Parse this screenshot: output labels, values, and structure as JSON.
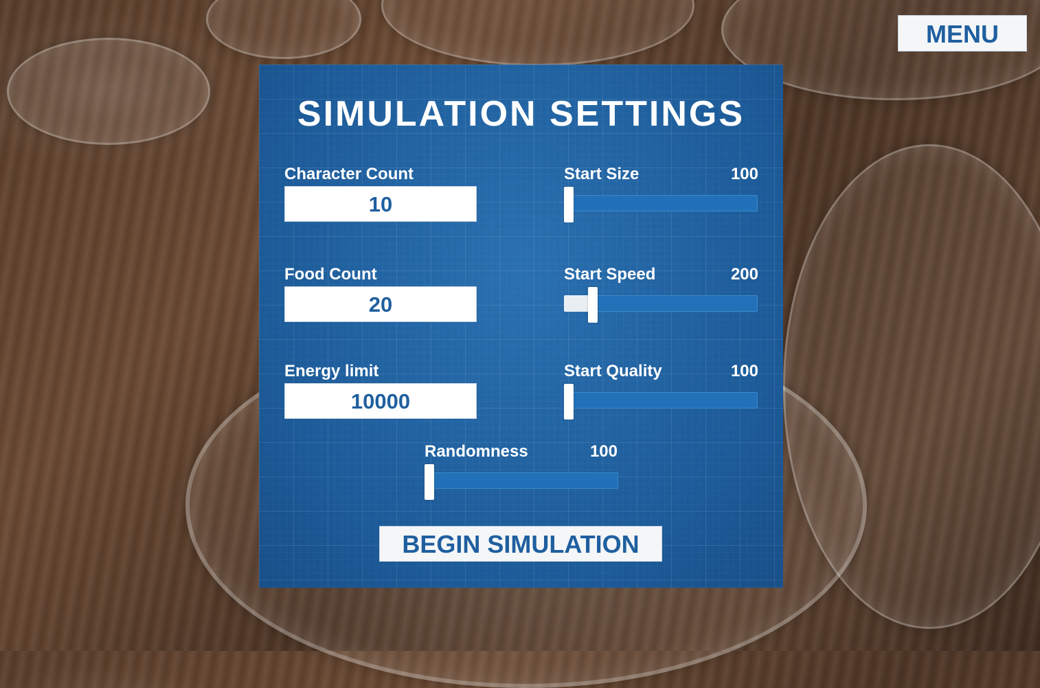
{
  "menu_label": "MENU",
  "panel": {
    "title": "SIMULATION SETTINGS",
    "inputs": [
      {
        "label": "Character Count",
        "value": "10"
      },
      {
        "label": "Food Count",
        "value": "20"
      },
      {
        "label": "Energy limit",
        "value": "10000"
      }
    ],
    "sliders": [
      {
        "label": "Start Size",
        "value": "100",
        "level": 0.0
      },
      {
        "label": "Start Speed",
        "value": "200",
        "level": 0.13
      },
      {
        "label": "Start Quality",
        "value": "100",
        "level": 0.0
      },
      {
        "label": "Randomness",
        "value": "100",
        "level": 0.0
      }
    ],
    "begin_label": "BEGIN SIMULATION"
  }
}
